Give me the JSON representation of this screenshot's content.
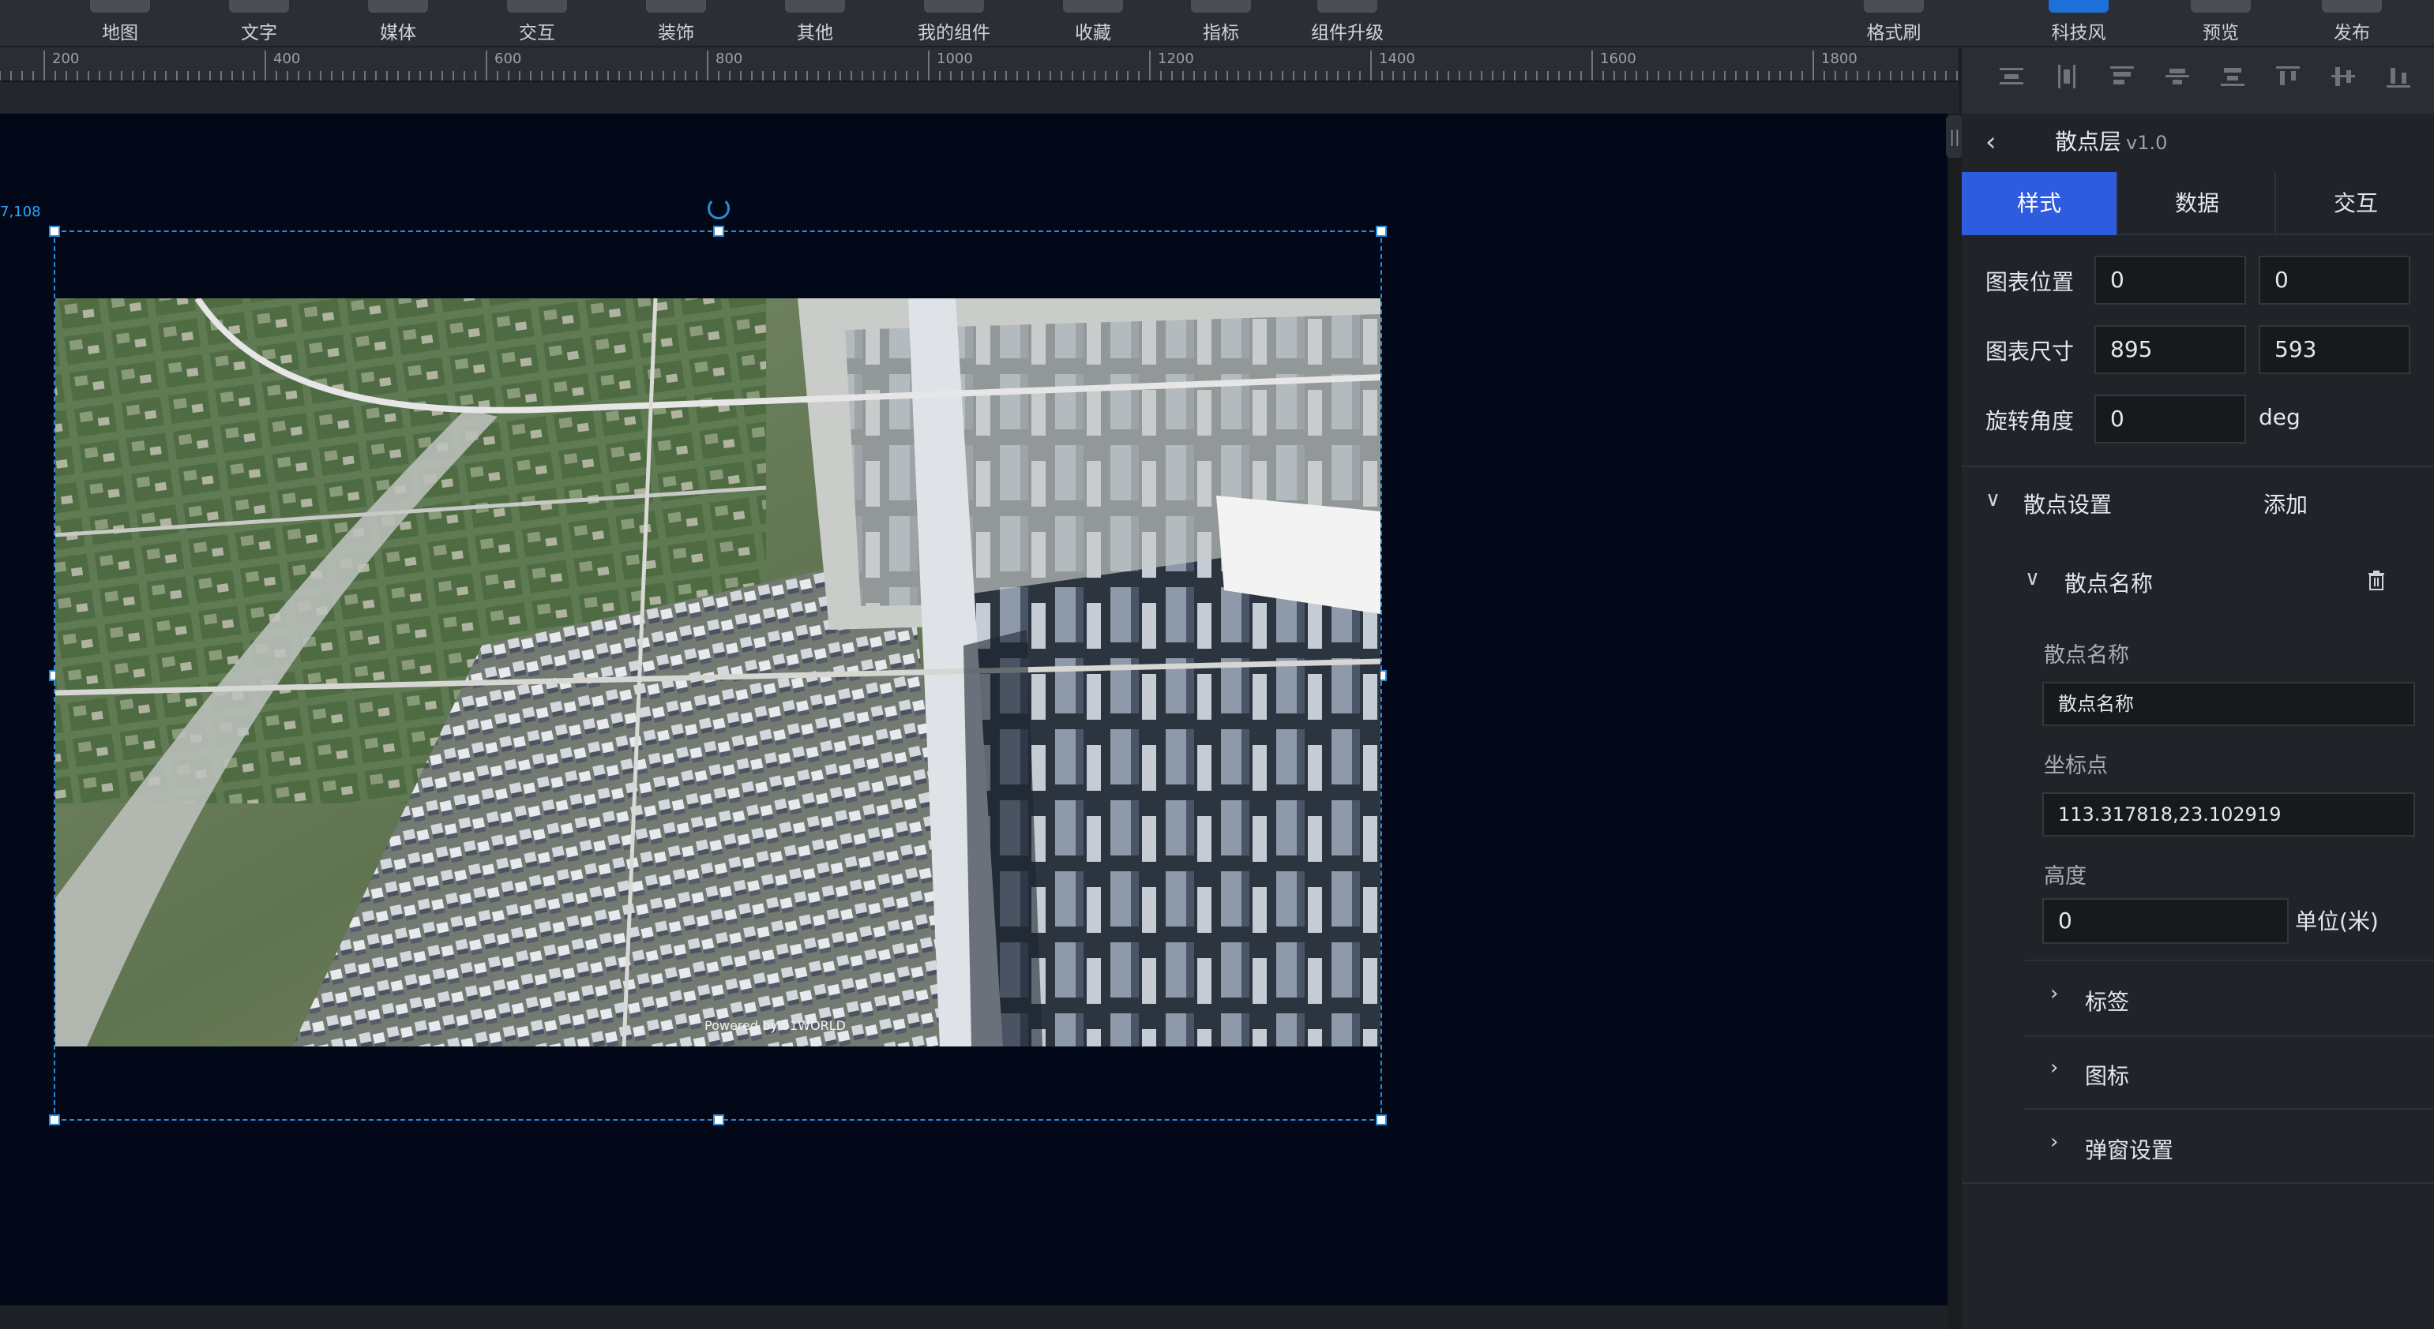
{
  "toolbar": {
    "items": [
      {
        "label": "地图"
      },
      {
        "label": "文字"
      },
      {
        "label": "媒体"
      },
      {
        "label": "交互"
      },
      {
        "label": "装饰"
      },
      {
        "label": "其他"
      },
      {
        "label": "我的组件"
      },
      {
        "label": "收藏"
      },
      {
        "label": "指标"
      },
      {
        "label": "组件升级"
      }
    ],
    "right_items": [
      {
        "label": "格式刷"
      },
      {
        "label": "科技风"
      },
      {
        "label": "预览"
      },
      {
        "label": "发布"
      }
    ]
  },
  "ruler": {
    "labels": [
      "200",
      "400",
      "600",
      "800",
      "1000",
      "1200",
      "1400",
      "1600",
      "1800"
    ]
  },
  "canvas": {
    "coord_label": "7,108",
    "map_watermark": "Powered by 51WORLD"
  },
  "panel": {
    "title": "散点层",
    "version": "v1.0",
    "tabs": [
      {
        "label": "样式"
      },
      {
        "label": "数据"
      },
      {
        "label": "交互"
      }
    ],
    "position": {
      "label": "图表位置",
      "x": "0",
      "y": "0"
    },
    "size": {
      "label": "图表尺寸",
      "w": "895",
      "h": "593"
    },
    "rotation": {
      "label": "旋转角度",
      "value": "0",
      "unit": "deg"
    },
    "scatter_settings": {
      "label": "散点设置",
      "add": "添加"
    },
    "scatter_item": {
      "header": "散点名称",
      "name_label": "散点名称",
      "name_value": "散点名称",
      "coord_label": "坐标点",
      "coord_value": "113.317818,23.102919",
      "height_label": "高度",
      "height_value": "0",
      "height_unit": "单位(米)"
    },
    "collapsed_sections": [
      {
        "label": "标签"
      },
      {
        "label": "图标"
      },
      {
        "label": "弹窗设置"
      }
    ]
  },
  "colors": {
    "accent": "#2f5bdf",
    "selection": "#2b8bd6",
    "canvas_bg": "#020818"
  }
}
